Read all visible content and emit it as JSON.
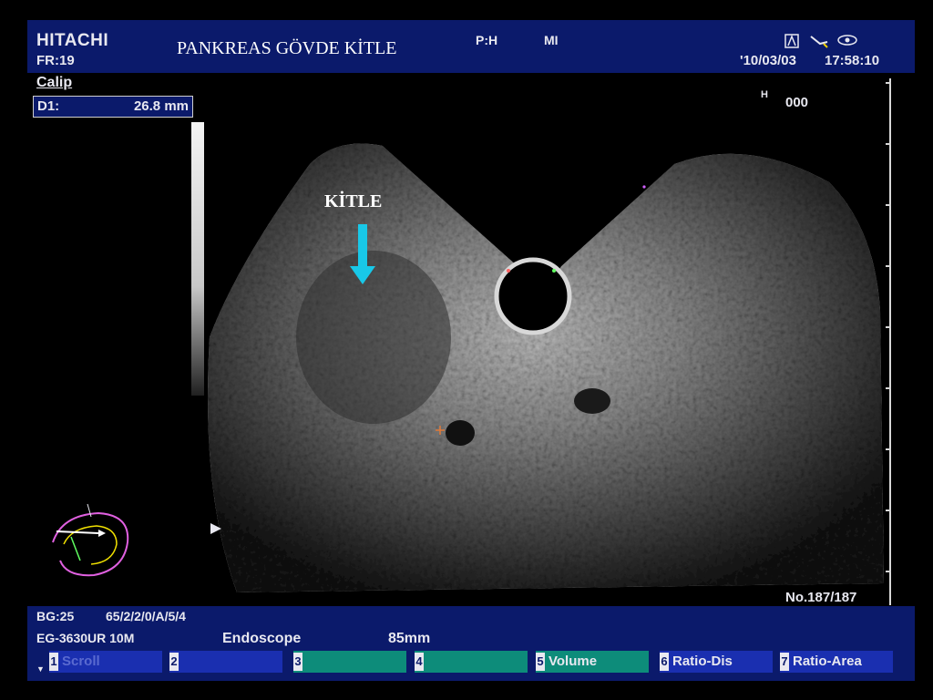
{
  "header": {
    "brand": "HITACHI",
    "frame_rate": "FR:19",
    "title": "PANKREAS GÖVDE KİTLE",
    "ph": "P:H",
    "mi": "MI",
    "date": "'10/03/03",
    "time": "17:58:10"
  },
  "measure": {
    "mode": "Calip",
    "d1_label": "D1:",
    "d1_value": "26.8 mm"
  },
  "gain": {
    "h_label": "H",
    "value": "000"
  },
  "image": {
    "annotation": "KİTLE",
    "frame_counter": "No.187/187"
  },
  "status": {
    "bg": "BG:25",
    "params": "65/2/2/0/A/5/4",
    "probe": "EG-3630UR 10M",
    "mode": "Endoscope",
    "depth": "85mm"
  },
  "softkeys": [
    {
      "num": "1",
      "label": "Scroll"
    },
    {
      "num": "2",
      "label": ""
    },
    {
      "num": "3",
      "label": ""
    },
    {
      "num": "4",
      "label": ""
    },
    {
      "num": "5",
      "label": "Volume"
    },
    {
      "num": "6",
      "label": "Ratio-Dis"
    },
    {
      "num": "7",
      "label": "Ratio-Area"
    }
  ],
  "colors": {
    "panel": "#0b1a6b",
    "key_blue": "#1a2fb0",
    "key_teal": "#0d8c7a",
    "arrow": "#18c8e8"
  }
}
